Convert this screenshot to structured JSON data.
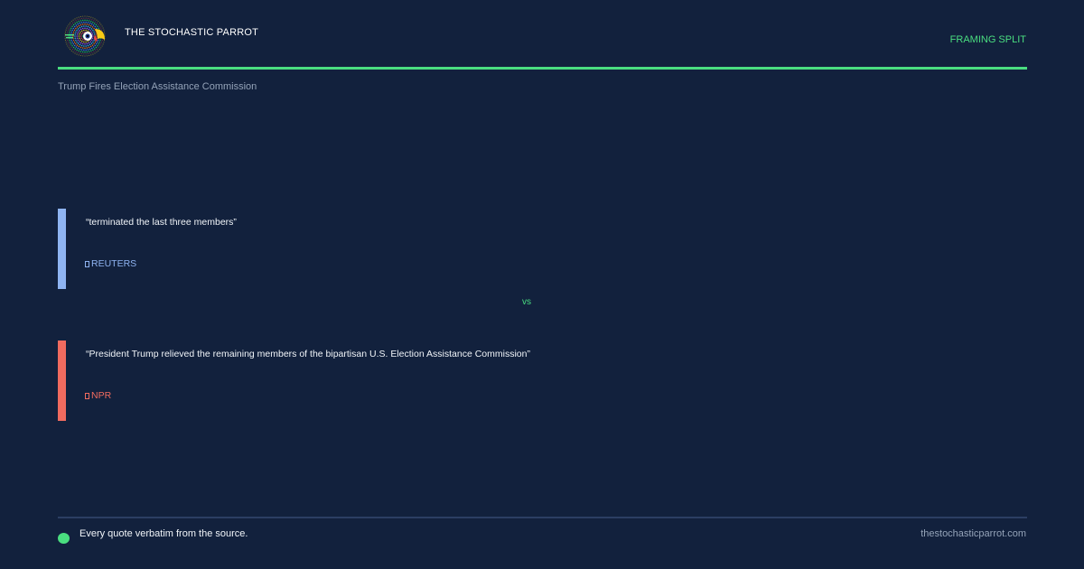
{
  "header": {
    "brand_name": "THE STOCHASTIC PARROT",
    "framing_label": "FRAMING SPLIT",
    "logo_icon": "parrot-logo-icon"
  },
  "story": {
    "title": "Trump Fires Election Assistance Commission"
  },
  "quotes": [
    {
      "text": "“terminated the last three members”",
      "source": "REUTERS",
      "source_icon": "source-icon",
      "accent_color": "#8fb4f2"
    },
    {
      "text": "“President Trump relieved the remaining members of the bipartisan U.S. Election Assistance Commission”",
      "source": "NPR",
      "source_icon": "source-icon",
      "accent_color": "#f06b5f"
    }
  ],
  "divider": {
    "label": "vs"
  },
  "footer": {
    "note": "Every quote verbatim from the source.",
    "site": "thestochasticparrot.com"
  },
  "colors": {
    "background": "#12213d",
    "accent": "#4ade80",
    "muted_text": "#94a3b8"
  }
}
